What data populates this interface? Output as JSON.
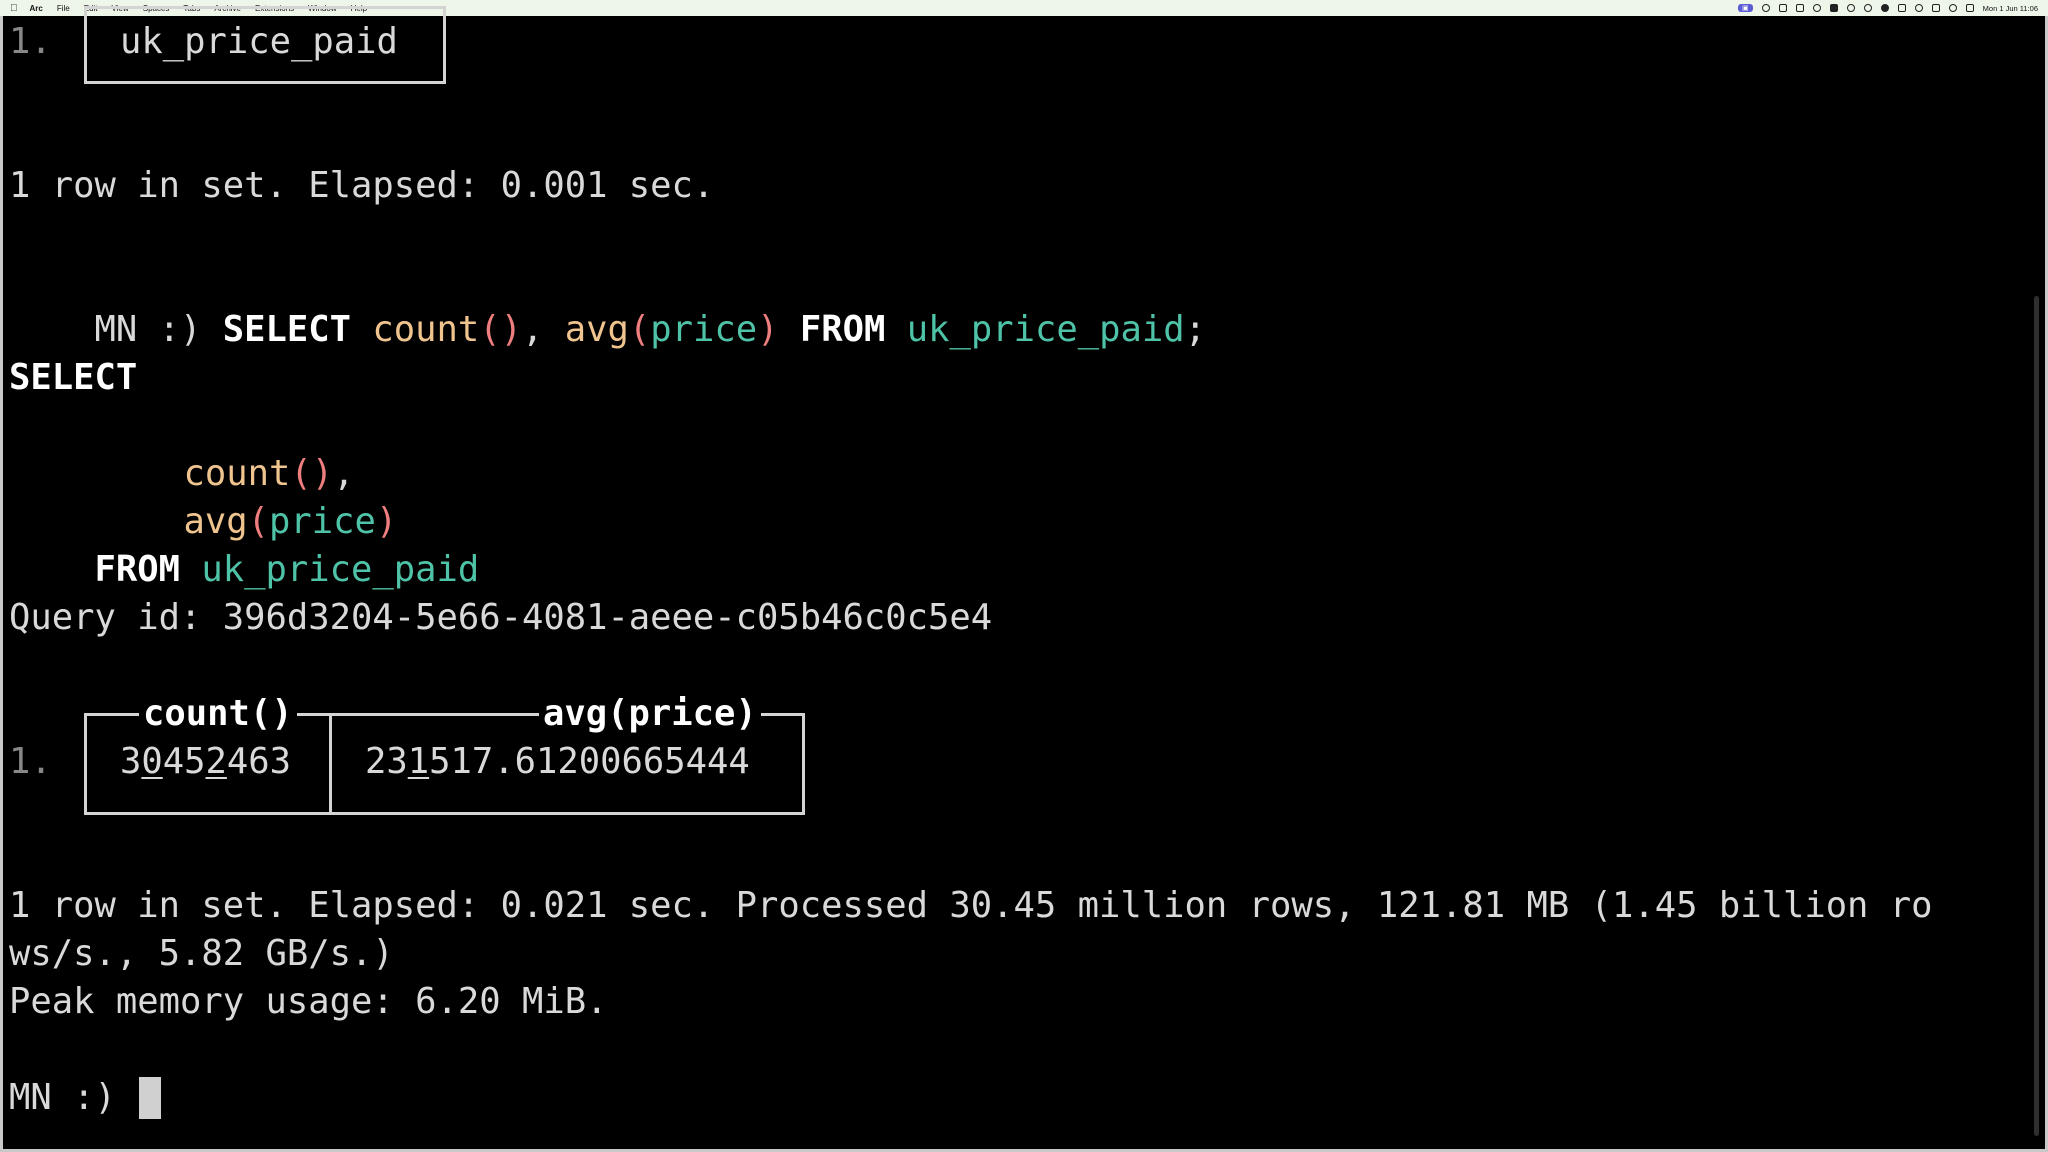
{
  "menubar": {
    "apple_icon": "apple-icon",
    "items": [
      "Arc",
      "File",
      "Edit",
      "View",
      "Spaces",
      "Tabs",
      "Archive",
      "Extensions",
      "Window",
      "Help"
    ],
    "clock": "Mon 1 Jun 11:06"
  },
  "terminal": {
    "table1": {
      "row_num": "1.",
      "value": "uk_price_paid"
    },
    "result1": "1 row in set. Elapsed: 0.001 sec.",
    "prompt": "MN :)",
    "query": {
      "select": "SELECT",
      "count": "count",
      "count_parens": "()",
      "comma": ",",
      "avg": "avg",
      "paren_open": "(",
      "price": "price",
      "paren_close": ")",
      "from": "FROM",
      "table": "uk_price_paid",
      "semicolon": ";"
    },
    "query_id": "Query id: 396d3204-5e66-4081-aeee-c05b46c0c5e4",
    "table2": {
      "row_num": "1.",
      "headers": [
        "count()",
        "avg(price)"
      ],
      "count_value": [
        "3",
        "0",
        "45",
        "2",
        "463"
      ],
      "avg_value": [
        "23",
        "1",
        "517.61200665444"
      ]
    },
    "result2_line1": "1 row in set. Elapsed: 0.021 sec. Processed 30.45 million rows, 121.81 MB (1.45 billion ro",
    "result2_line2": "ws/s., 5.82 GB/s.)",
    "peak_memory": "Peak memory usage: 6.20 MiB.",
    "final_prompt": "MN :)"
  }
}
